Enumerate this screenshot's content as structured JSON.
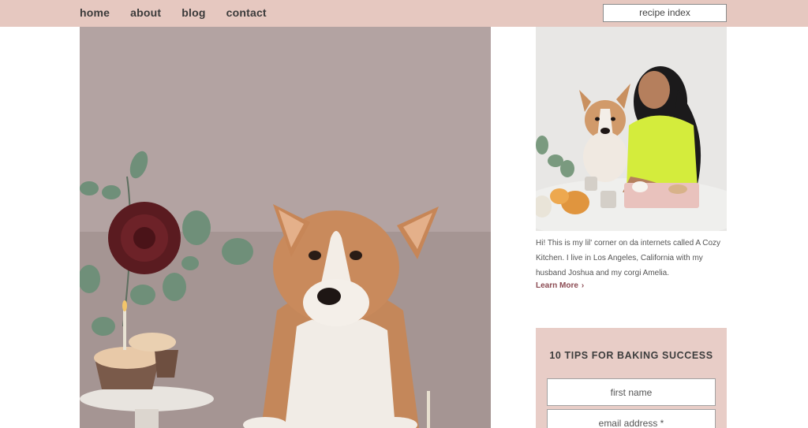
{
  "nav": {
    "items": [
      "home",
      "about",
      "blog",
      "contact"
    ],
    "recipe_index": "recipe index"
  },
  "hero": {
    "image": "corgi-portrait-photo"
  },
  "sidebar": {
    "profile_image": "woman-with-corgi-photo",
    "bio": "Hi! This is my lil' corner on da internets called A Cozy Kitchen. I live in Los Angeles, California with my husband Joshua and my corgi Amelia.",
    "learn_more": "Learn More",
    "learn_more_icon": "chevron-right-icon"
  },
  "optin": {
    "title": "10 TIPS FOR BAKING SUCCESS",
    "first_name_placeholder": "first name",
    "email_placeholder": "email address *"
  },
  "colors": {
    "topbar": "#e6c8c0",
    "optin_bg": "#e8cdc7",
    "accent": "#8b4a52"
  }
}
